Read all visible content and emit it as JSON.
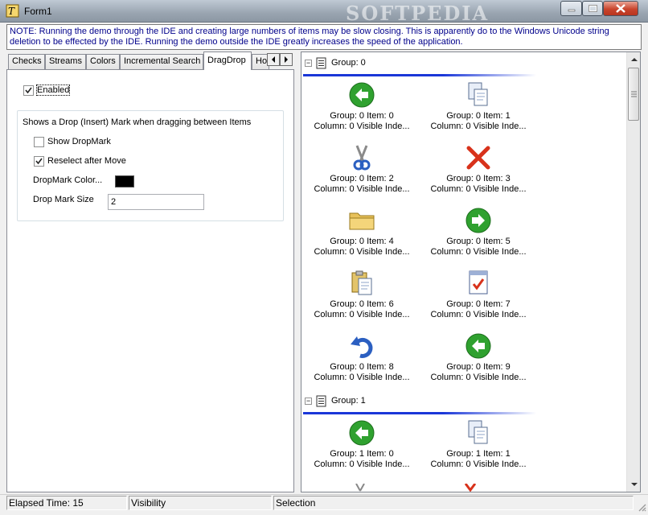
{
  "window": {
    "title": "Form1",
    "watermark": "SOFTPEDIA"
  },
  "note": "NOTE:  Running the demo through the IDE and creating large numbers of items may be slow closing.  This is apparently do to the Windows Unicode string deletion to be effected by the IDE.  Running the demo outside the IDE greatly increases the speed of the application.",
  "tabs": [
    {
      "label": "Checks"
    },
    {
      "label": "Streams"
    },
    {
      "label": "Colors"
    },
    {
      "label": "Incremental Search"
    },
    {
      "label": "DragDrop"
    },
    {
      "label": "Ho"
    }
  ],
  "dragdrop": {
    "enabled_label": "Enabled",
    "group_caption": "Shows a Drop (Insert) Mark when dragging between Items",
    "show_dropmark_label": "Show DropMark",
    "reselect_label": "Reselect after Move",
    "dropmark_color_label": "DropMark Color...",
    "dropmark_color": "#000000",
    "dropmark_size_label": "Drop Mark Size",
    "dropmark_size_value": "2"
  },
  "listview": {
    "groups": [
      {
        "label": "Group: 0",
        "items": [
          {
            "l1": "Group: 0 Item: 0",
            "l2": "Column: 0 Visible Inde...",
            "icon": "back-arrow-icon"
          },
          {
            "l1": "Group: 0 Item: 1",
            "l2": "Column: 0 Visible Inde...",
            "icon": "copy-icon"
          },
          {
            "l1": "Group: 0 Item: 2",
            "l2": "Column: 0 Visible Inde...",
            "icon": "scissors-icon"
          },
          {
            "l1": "Group: 0 Item: 3",
            "l2": "Column: 0 Visible Inde...",
            "icon": "delete-x-icon"
          },
          {
            "l1": "Group: 0 Item: 4",
            "l2": "Column: 0 Visible Inde...",
            "icon": "folder-icon"
          },
          {
            "l1": "Group: 0 Item: 5",
            "l2": "Column: 0 Visible Inde...",
            "icon": "forward-arrow-icon"
          },
          {
            "l1": "Group: 0 Item: 6",
            "l2": "Column: 0 Visible Inde...",
            "icon": "paste-icon"
          },
          {
            "l1": "Group: 0 Item: 7",
            "l2": "Column: 0 Visible Inde...",
            "icon": "checked-document-icon"
          },
          {
            "l1": "Group: 0 Item: 8",
            "l2": "Column: 0 Visible Inde...",
            "icon": "undo-icon"
          },
          {
            "l1": "Group: 0 Item: 9",
            "l2": "Column: 0 Visible Inde...",
            "icon": "back-arrow-icon"
          }
        ]
      },
      {
        "label": "Group: 1",
        "items": [
          {
            "l1": "Group: 1 Item: 0",
            "l2": "Column: 0 Visible Inde...",
            "icon": "back-arrow-icon"
          },
          {
            "l1": "Group: 1 Item: 1",
            "l2": "Column: 0 Visible Inde...",
            "icon": "copy-icon"
          }
        ]
      }
    ]
  },
  "statusbar": {
    "elapsed": "Elapsed Time: 15",
    "visibility": "Visibility",
    "selection": "Selection"
  },
  "colors": {
    "accent_line": "#1a37d8",
    "note_text": "#00008b",
    "green_arrow": "#2fa12f",
    "red_x": "#d8321b"
  }
}
